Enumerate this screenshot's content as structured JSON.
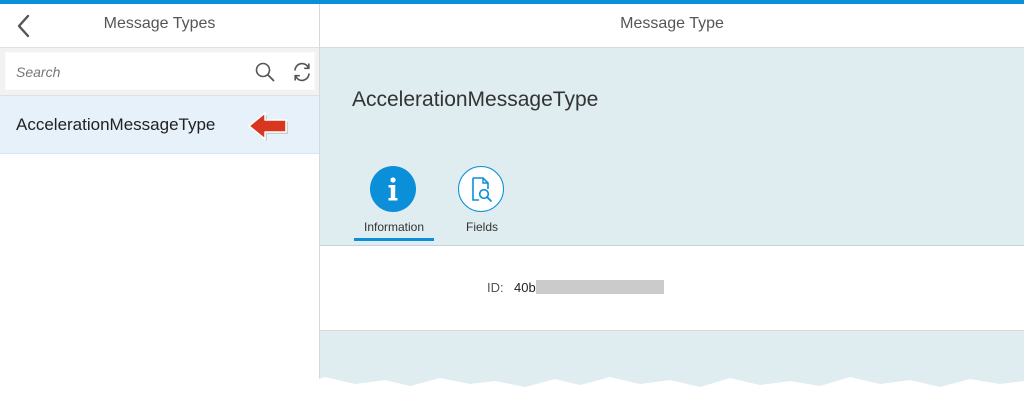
{
  "colors": {
    "accent": "#0a8fd8",
    "header_bg": "#dfecf0",
    "selected_item_bg": "#e6f1fa",
    "annotation_arrow": "#d9361f"
  },
  "master": {
    "title": "Message Types",
    "back_icon": "chevron-left-icon",
    "search": {
      "placeholder": "Search",
      "value": "",
      "search_icon": "search-icon",
      "refresh_icon": "refresh-icon"
    },
    "items": [
      {
        "label": "AccelerationMessageType",
        "selected": true
      }
    ]
  },
  "detail": {
    "title": "Message Type",
    "object_title": "AccelerationMessageType",
    "tabs": [
      {
        "label": "Information",
        "icon": "info-icon",
        "selected": true
      },
      {
        "label": "Fields",
        "icon": "document-search-icon",
        "selected": false
      }
    ],
    "fields": [
      {
        "label": "ID:",
        "value": "40b",
        "redacted": true
      }
    ]
  }
}
